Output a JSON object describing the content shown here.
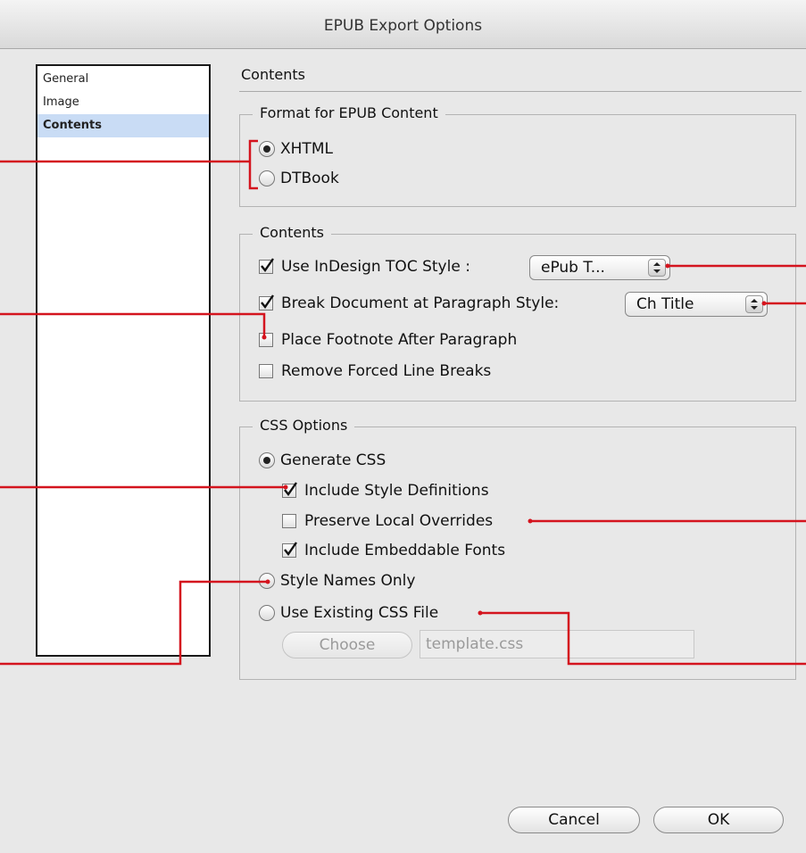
{
  "window": {
    "title": "EPUB Export Options"
  },
  "sidebar": {
    "items": [
      {
        "label": "General",
        "selected": false
      },
      {
        "label": "Image",
        "selected": false
      },
      {
        "label": "Contents",
        "selected": true
      }
    ]
  },
  "section": {
    "title": "Contents"
  },
  "format_group": {
    "legend": "Format for EPUB Content",
    "xhtml_label": "XHTML",
    "xhtml_selected": true,
    "dtbook_label": "DTBook",
    "dtbook_selected": false
  },
  "contents_group": {
    "legend": "Contents",
    "toc_label": "Use InDesign TOC Style :",
    "toc_checked": true,
    "toc_value": "ePub T...",
    "break_label": "Break Document at Paragraph Style:",
    "break_checked": true,
    "break_value": "Ch Title",
    "footnote_label": "Place Footnote After Paragraph",
    "footnote_checked": false,
    "linebreaks_label": "Remove Forced Line Breaks",
    "linebreaks_checked": false
  },
  "css_group": {
    "legend": "CSS Options",
    "generate_label": "Generate CSS",
    "generate_selected": true,
    "include_defs_label": "Include Style Definitions",
    "include_defs_checked": true,
    "preserve_label": "Preserve Local Overrides",
    "preserve_checked": false,
    "fonts_label": "Include Embeddable Fonts",
    "fonts_checked": true,
    "names_only_label": "Style Names Only",
    "names_only_selected": false,
    "existing_label": "Use Existing CSS File",
    "existing_selected": false,
    "choose_label": "Choose",
    "css_file": "template.css"
  },
  "footer": {
    "cancel_label": "Cancel",
    "ok_label": "OK"
  },
  "colors": {
    "callout": "#d4141e",
    "selection": "#c9dcf5"
  },
  "icons": [
    "radio-selected",
    "radio-empty",
    "checkmark-icon",
    "updown-arrows-icon"
  ]
}
